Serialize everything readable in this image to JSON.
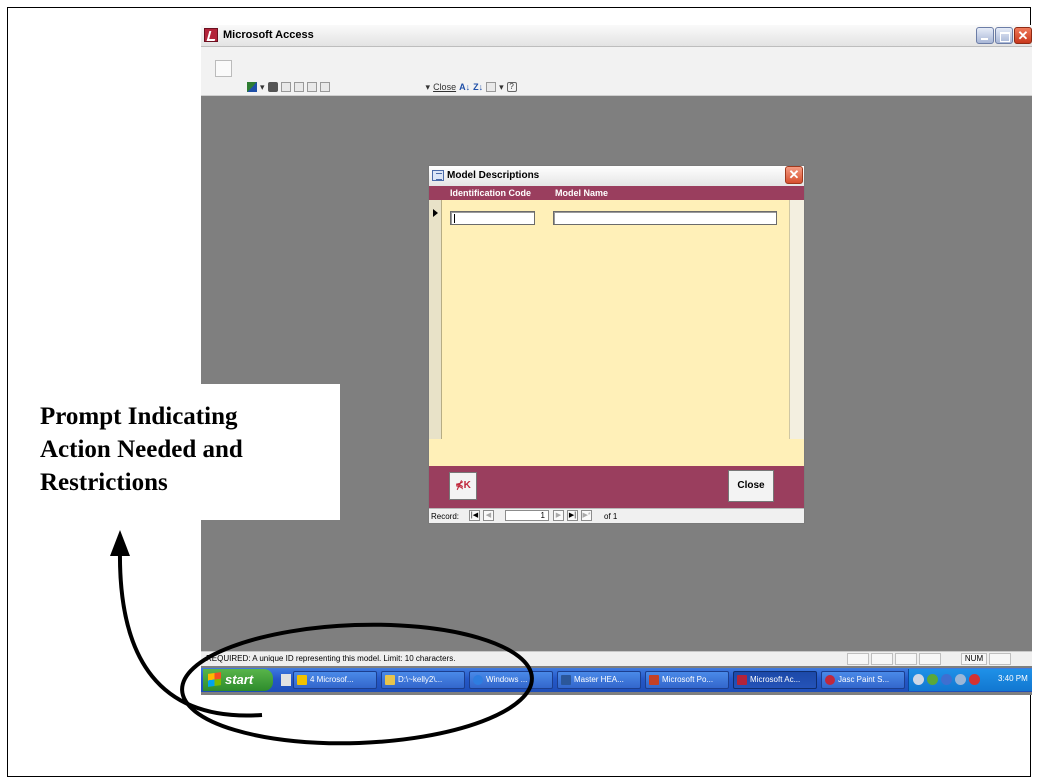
{
  "window": {
    "title": "Microsoft Access"
  },
  "toolbar": {
    "close_label": "Close"
  },
  "form": {
    "title": "Model Descriptions",
    "columns": [
      "Identification Code",
      "Model Name"
    ],
    "undo_label": "⋠K",
    "close_label": "Close",
    "navigation": {
      "label": "Record:",
      "current": "1",
      "of_label": "of 1"
    }
  },
  "statusbar": {
    "text": "REQUIRED:  A unique ID representing this model.   Limit:  10 characters.",
    "num_indicator": "NUM"
  },
  "taskbar": {
    "start_label": "start",
    "tasks": [
      {
        "label": "4 Microsof...",
        "icon_color": "#f2c200"
      },
      {
        "label": "D:\\~kelly2\\...",
        "icon_color": "#e8c44c"
      },
      {
        "label": "Windows ...",
        "icon_color": "#2e7de0"
      },
      {
        "label": "Master HEA...",
        "icon_color": "#2b579a"
      },
      {
        "label": "Microsoft Po...",
        "icon_color": "#c44125"
      },
      {
        "label": "Microsoft Ac...",
        "icon_color": "#b3243a"
      },
      {
        "label": "Jasc Paint S...",
        "icon_color": "#c0283c"
      }
    ],
    "clock": "3:40 PM"
  },
  "annotation": {
    "lines": [
      "Prompt Indicating",
      "Action Needed and",
      "Restrictions"
    ]
  }
}
